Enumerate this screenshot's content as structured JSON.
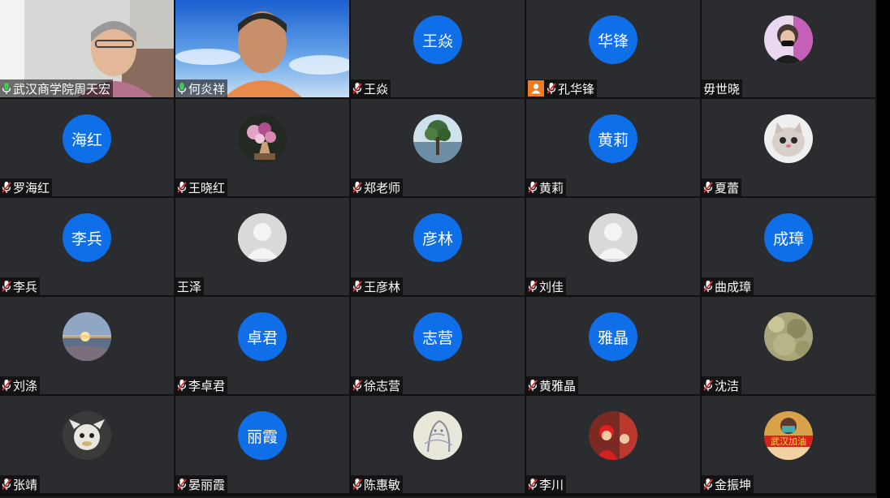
{
  "participants": [
    {
      "name": "武汉商学院周天宏",
      "type": "video",
      "mic": "on"
    },
    {
      "name": "何炎祥",
      "type": "video",
      "mic": "on"
    },
    {
      "name": "王焱",
      "type": "initials",
      "initials": "王焱",
      "mic": "off"
    },
    {
      "name": "孔华锋",
      "type": "initials",
      "initials": "华锋",
      "mic": "off",
      "host_badge": true
    },
    {
      "name": "毋世晓",
      "type": "photo",
      "photo": "woman-mask",
      "mic": "none"
    },
    {
      "name": "罗海红",
      "type": "initials",
      "initials": "海红",
      "mic": "off"
    },
    {
      "name": "王晓红",
      "type": "photo",
      "photo": "flowers",
      "mic": "off"
    },
    {
      "name": "郑老师",
      "type": "photo",
      "photo": "tree",
      "mic": "off"
    },
    {
      "name": "黄莉",
      "type": "initials",
      "initials": "黄莉",
      "mic": "off"
    },
    {
      "name": "夏蕾",
      "type": "photo",
      "photo": "cat",
      "mic": "off"
    },
    {
      "name": "李兵",
      "type": "initials",
      "initials": "李兵",
      "mic": "off"
    },
    {
      "name": "王泽",
      "type": "default",
      "mic": "none"
    },
    {
      "name": "王彦林",
      "type": "initials",
      "initials": "彦林",
      "mic": "off"
    },
    {
      "name": "刘佳",
      "type": "default",
      "mic": "off"
    },
    {
      "name": "曲成璋",
      "type": "initials",
      "initials": "成璋",
      "mic": "off"
    },
    {
      "name": "刘涤",
      "type": "photo",
      "photo": "sunset",
      "mic": "off"
    },
    {
      "name": "李卓君",
      "type": "initials",
      "initials": "卓君",
      "mic": "off"
    },
    {
      "name": "徐志营",
      "type": "initials",
      "initials": "志营",
      "mic": "off"
    },
    {
      "name": "黄雅晶",
      "type": "initials",
      "initials": "雅晶",
      "mic": "off"
    },
    {
      "name": "沈洁",
      "type": "photo",
      "photo": "foliage",
      "mic": "off"
    },
    {
      "name": "张靖",
      "type": "photo",
      "photo": "toy",
      "mic": "off"
    },
    {
      "name": "晏丽霞",
      "type": "initials",
      "initials": "丽霞",
      "mic": "off"
    },
    {
      "name": "陈惠敏",
      "type": "photo",
      "photo": "sketch",
      "mic": "off"
    },
    {
      "name": "李川",
      "type": "photo",
      "photo": "red-kids",
      "mic": "off"
    },
    {
      "name": "金振坤",
      "type": "photo",
      "photo": "wuhan-banner",
      "banner_text": "武汉加油",
      "mic": "off"
    }
  ],
  "colors": {
    "initials_bg": "#0f6fe8",
    "tile_bg": "#2a2c2f",
    "mic_on": "#3fcf4e",
    "mic_off": "#e0312f",
    "host": "#f07b1e"
  }
}
